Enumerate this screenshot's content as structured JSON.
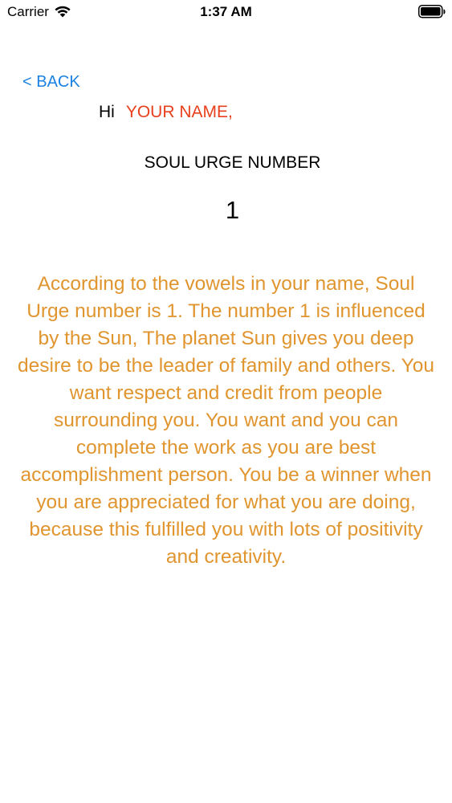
{
  "status_bar": {
    "carrier": "Carrier",
    "time": "1:37 AM",
    "icons": [
      "wifi-icon",
      "battery-icon"
    ]
  },
  "nav": {
    "back_label": "< BACK"
  },
  "greeting": {
    "hi": "Hi",
    "name": "YOUR NAME,"
  },
  "result": {
    "heading": "SOUL URGE NUMBER",
    "number": "1",
    "description": "According to the vowels in your name, Soul Urge number is 1. The number 1 is influenced by the Sun, The planet Sun gives you deep desire to be the leader of family and others. You want respect and credit from people surrounding you. You want and you can complete the work as you are best accomplishment person. You be a winner when you are appreciated for what you are doing, because this fulfilled you with lots of positivity and creativity."
  },
  "colors": {
    "accent_blue": "#1a82e2",
    "name_red": "#e8401c",
    "description_orange": "#e0952f"
  }
}
